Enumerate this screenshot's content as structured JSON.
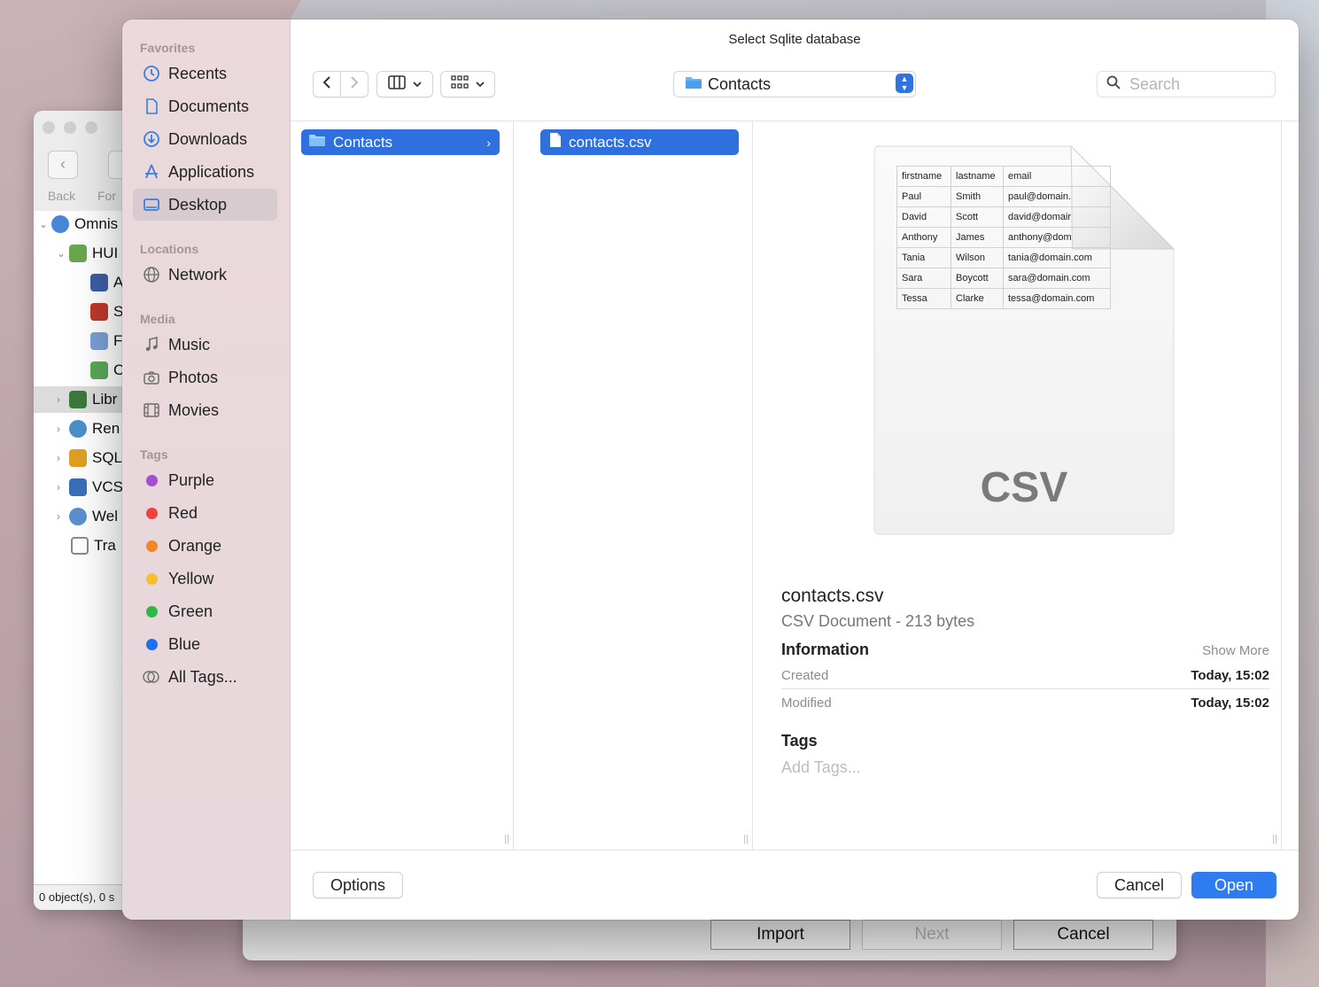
{
  "background_window": {
    "back_label": "Back",
    "forward_label": "For",
    "tree": [
      {
        "label": "Omnis",
        "color": "#4a86d8"
      },
      {
        "label": "HUI",
        "color": "#6aa84f"
      },
      {
        "label": "A",
        "color": "#3d5fa8"
      },
      {
        "label": "S",
        "color": "#c0392b"
      },
      {
        "label": "F",
        "color": "#7aa0d8"
      },
      {
        "label": "C",
        "color": "#5aa85a"
      },
      {
        "label": "Libr",
        "color": "#3a7a3a"
      },
      {
        "label": "Ren",
        "color": "#4a90c8"
      },
      {
        "label": "SQL",
        "color": "#e0a020"
      },
      {
        "label": "VCS",
        "color": "#3a6fb8"
      },
      {
        "label": "Wel",
        "color": "#5a8fd0"
      },
      {
        "label": "Tra",
        "color": "#8a8a8a"
      }
    ],
    "status": "0 object(s), 0 s"
  },
  "background_dialog": {
    "import_label": "Import",
    "next_label": "Next",
    "cancel_label": "Cancel"
  },
  "dialog": {
    "title": "Select Sqlite database",
    "path_popup": "Contacts",
    "search_placeholder": "Search",
    "sidebar": {
      "favorites_header": "Favorites",
      "favorites": [
        "Recents",
        "Documents",
        "Downloads",
        "Applications",
        "Desktop"
      ],
      "selected": "Desktop",
      "locations_header": "Locations",
      "locations": [
        "Network"
      ],
      "media_header": "Media",
      "media": [
        "Music",
        "Photos",
        "Movies"
      ],
      "tags_header": "Tags",
      "tags": [
        {
          "label": "Purple",
          "color": "#a24fd1"
        },
        {
          "label": "Red",
          "color": "#f2403a"
        },
        {
          "label": "Orange",
          "color": "#f2862a"
        },
        {
          "label": "Yellow",
          "color": "#f5c02b"
        },
        {
          "label": "Green",
          "color": "#2fb84a"
        },
        {
          "label": "Blue",
          "color": "#1f6ff0"
        }
      ],
      "all_tags": "All Tags..."
    },
    "columns": {
      "col1_item": "Contacts",
      "col2_item": "contacts.csv"
    },
    "preview": {
      "table_headers": [
        "firstname",
        "lastname",
        "email"
      ],
      "table_rows": [
        [
          "Paul",
          "Smith",
          "paul@domain."
        ],
        [
          "David",
          "Scott",
          "david@domair"
        ],
        [
          "Anthony",
          "James",
          "anthony@dom"
        ],
        [
          "Tania",
          "Wilson",
          "tania@domain.com"
        ],
        [
          "Sara",
          "Boycott",
          "sara@domain.com"
        ],
        [
          "Tessa",
          "Clarke",
          "tessa@domain.com"
        ]
      ],
      "doc_type_label": "CSV",
      "file_name": "contacts.csv",
      "file_kind": "CSV Document - 213 bytes",
      "information_header": "Information",
      "show_more": "Show More",
      "created_label": "Created",
      "created_value": "Today, 15:02",
      "modified_label": "Modified",
      "modified_value": "Today, 15:02",
      "tags_header": "Tags",
      "add_tags": "Add Tags..."
    },
    "footer": {
      "options_label": "Options",
      "cancel_label": "Cancel",
      "open_label": "Open"
    },
    "accent_color": "#2f7bf0"
  }
}
